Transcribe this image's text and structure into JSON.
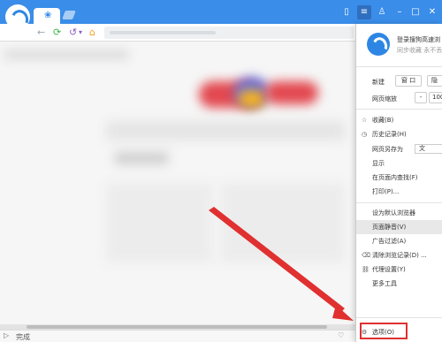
{
  "browser": {
    "tab_icon": "paw-icon",
    "window_buttons": [
      "sidebar-icon",
      "menu-icon",
      "skin-icon",
      "minimize-icon",
      "restore-icon",
      "close-icon"
    ]
  },
  "toolbar": {
    "back": "←",
    "refresh": "⟳",
    "undo": "↺",
    "undo_drop": "▾",
    "home": "⌂"
  },
  "menu": {
    "login": "登录搜狗高速浏",
    "sync": "同步收藏 永不丢",
    "new_label": "新建",
    "new_window": "窗 口",
    "new_incognito": "隐",
    "zoom_label": "网页缩放",
    "zoom_minus": "-",
    "zoom_value": "100",
    "items": [
      {
        "label": "收藏(B)",
        "icon": "☆"
      },
      {
        "label": "历史记录(H)",
        "icon": "◷"
      },
      {
        "label": "网页另存为",
        "icon": "",
        "right": "文"
      },
      {
        "label": "显示",
        "icon": ""
      },
      {
        "label": "在页面内查找(F)",
        "icon": ""
      },
      {
        "label": "打印(P)...",
        "icon": ""
      },
      {
        "label": "设为默认浏览器",
        "icon": ""
      },
      {
        "label": "页面静音(V)",
        "icon": ""
      },
      {
        "label": "广告过滤(A)",
        "icon": ""
      },
      {
        "label": "清除浏览记录(D) ...",
        "icon": "⌫"
      },
      {
        "label": "代理设置(Y)",
        "icon": "⛓"
      },
      {
        "label": "更多工具",
        "icon": ""
      }
    ],
    "options": "选项(O)"
  },
  "status": {
    "text": "完成"
  },
  "colors": {
    "titlebar": "#3a8de8",
    "accent": "#2e86e4",
    "annotation": "#e03030"
  }
}
